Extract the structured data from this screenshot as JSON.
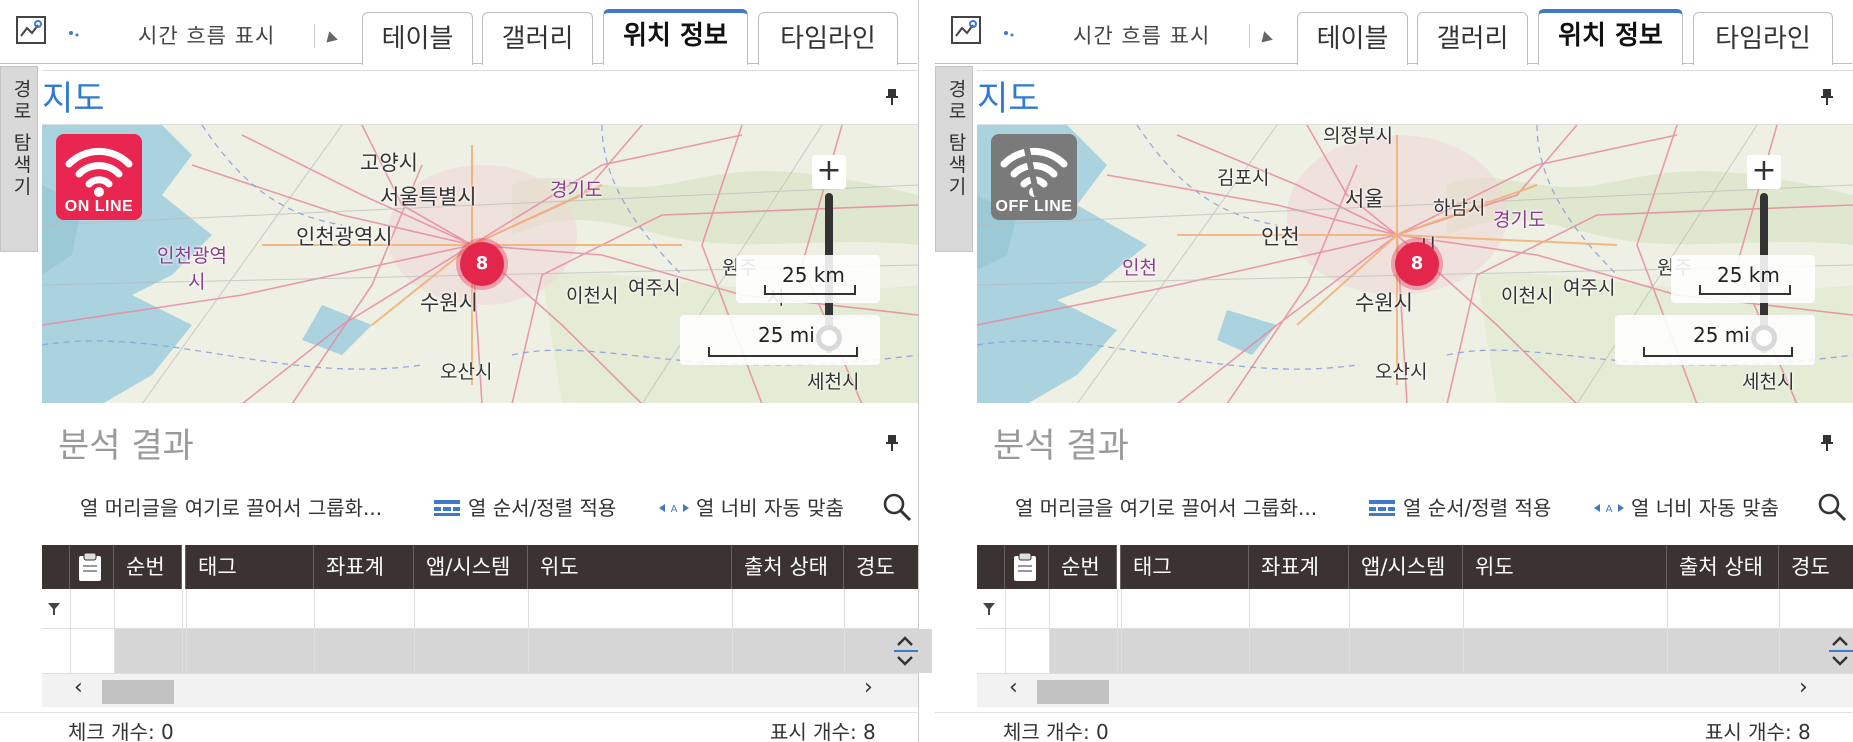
{
  "toolbar": {
    "time_flow": "시간 흐름 표시",
    "tabs": [
      "테이블",
      "갤러리",
      "위치 정보",
      "타임라인"
    ],
    "active_tab": "위치 정보"
  },
  "side_tab": {
    "label": "경로 탐색기"
  },
  "map_section": {
    "title": "지도",
    "scale_km": "25 km",
    "scale_mi": "25 mi",
    "cluster_count": "8"
  },
  "results_section": {
    "title": "분석 결과",
    "group_hint": "열 머리글을 여기로 끌어서 그룹화...",
    "apply_order": "열 순서/정렬 적용",
    "auto_fit": "열 너비 자동 맞춤",
    "columns": [
      "순번",
      "태그",
      "좌표계",
      "앱/시스템",
      "위도",
      "출처 상태",
      "경도"
    ],
    "check_count": "체크 개수: 0",
    "display_count": "표시 개수: 8"
  },
  "panels": [
    {
      "status": "ON LINE",
      "status_color": "#e8264f",
      "map_labels": [
        "고양시",
        "서울특별시",
        "경기도",
        "인천광역시",
        "인천광역",
        "시",
        "수원시",
        "이천시",
        "여주시",
        "오산시",
        "원주",
        "세천시",
        "시"
      ]
    },
    {
      "status": "OFF LINE",
      "status_color": "#7a7a7a",
      "map_labels": [
        "의정부시",
        "김포시",
        "서울",
        "하남시",
        "경기도",
        "인천",
        "인천",
        "시",
        "수원시",
        "이천시",
        "여주시",
        "오산시",
        "원주",
        "세천시"
      ]
    }
  ],
  "colors": {
    "accent": "#3f79c9",
    "grid_header": "#3b3232",
    "cluster": "#e3264b",
    "map_water": "#aad3df",
    "map_land": "#eef0e4"
  }
}
